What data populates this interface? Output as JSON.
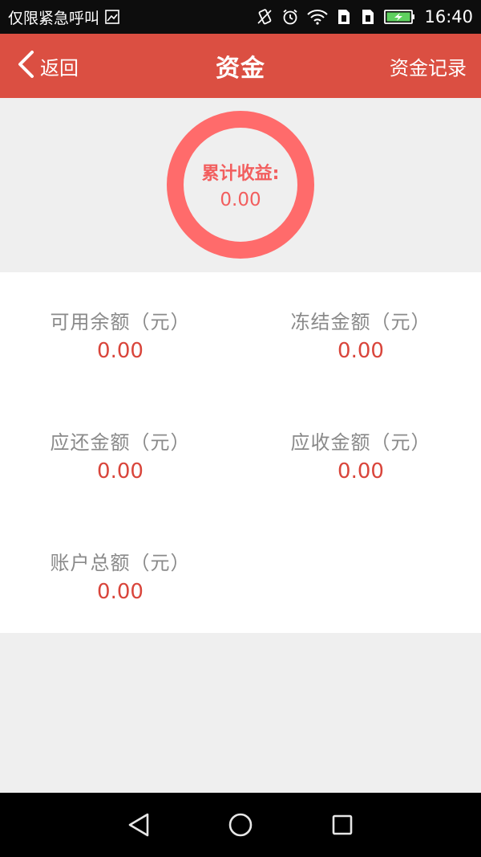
{
  "status_bar": {
    "carrier_text": "仅限紧急呼叫",
    "time": "16:40"
  },
  "header": {
    "back_label": "返回",
    "title": "资金",
    "records_link": "资金记录"
  },
  "earnings": {
    "label": "累计收益:",
    "value": "0.00"
  },
  "balances": [
    {
      "label": "可用余额（元）",
      "value": "0.00"
    },
    {
      "label": "冻结金额（元）",
      "value": "0.00"
    },
    {
      "label": "应还金额（元）",
      "value": "0.00"
    },
    {
      "label": "应收金额（元）",
      "value": "0.00"
    },
    {
      "label": "账户总额（元）",
      "value": "0.00"
    }
  ],
  "colors": {
    "header_bg": "#db4f42",
    "ring": "#ff6b6b",
    "value_red": "#d9453b"
  },
  "icons": {
    "status": [
      "image-icon",
      "vibrate-icon",
      "alarm-icon",
      "wifi-icon",
      "sim1-icon",
      "sim2-icon",
      "battery-charging-icon"
    ],
    "nav": [
      "back-triangle-icon",
      "home-circle-icon",
      "recents-square-icon"
    ]
  }
}
